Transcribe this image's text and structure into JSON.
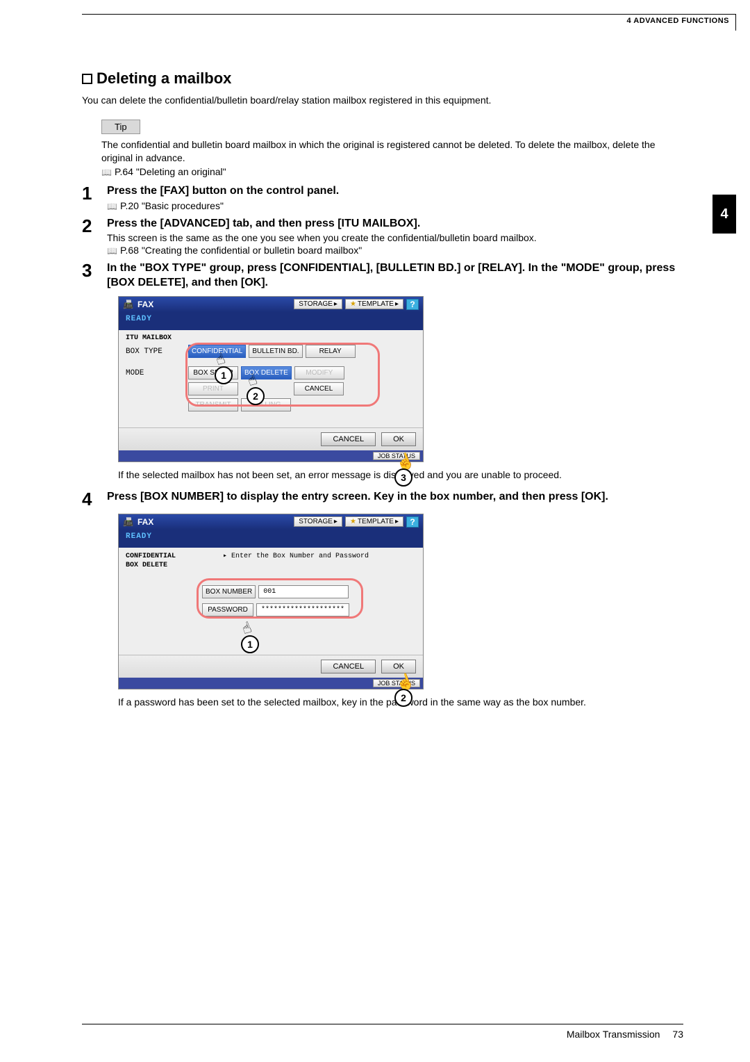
{
  "chapter_header": "4 ADVANCED FUNCTIONS",
  "side_tab": "4",
  "section_title": "Deleting a mailbox",
  "intro": "You can delete the confidential/bulletin board/relay station mailbox registered in this equipment.",
  "tip_label": "Tip",
  "tip_text": "The confidential and bulletin board mailbox in which the original is registered cannot be deleted. To delete the mailbox, delete the original in advance.",
  "tip_ref": "P.64 \"Deleting an original\"",
  "steps": {
    "s1": {
      "num": "1",
      "title": "Press the [FAX] button on the control panel.",
      "ref": "P.20 \"Basic procedures\""
    },
    "s2": {
      "num": "2",
      "title": "Press the [ADVANCED] tab, and then press [ITU MAILBOX].",
      "sub": "This screen is the same as the one you see when you create the confidential/bulletin board mailbox.",
      "ref": "P.68 \"Creating the confidential or bulletin board mailbox\""
    },
    "s3": {
      "num": "3",
      "title": "In the \"BOX TYPE\" group, press [CONFIDENTIAL], [BULLETIN BD.] or [RELAY]. In the \"MODE\" group, press [BOX DELETE], and then [OK].",
      "after": "If the selected mailbox has not been set, an error message is displayed and you are unable to proceed."
    },
    "s4": {
      "num": "4",
      "title": "Press [BOX NUMBER] to display the entry screen. Key in the box number, and then press [OK].",
      "after": "If a password has been set to the selected mailbox, key in the password in the same way as the box number."
    }
  },
  "panel": {
    "app": "FAX",
    "storage": "STORAGE",
    "template": "TEMPLATE",
    "ready": "READY",
    "itu": "ITU MAILBOX",
    "boxtype_lbl": "BOX TYPE",
    "mode_lbl": "MODE",
    "btns": {
      "confidential": "CONFIDENTIAL",
      "bulletin": "BULLETIN BD.",
      "relay": "RELAY",
      "boxsetup": "BOX SETUP",
      "boxdelete": "BOX DELETE",
      "modify": "MODIFY",
      "print": "PRINT",
      "cancel_small": "CANCEL",
      "transmit": "TRANSMIT",
      "polling": "POLLING"
    },
    "footer_cancel": "CANCEL",
    "footer_ok": "OK",
    "status": "JOB STATUS"
  },
  "panel2": {
    "left1": "CONFIDENTIAL",
    "left2": "BOX DELETE",
    "instr": "▸ Enter the Box Number and Password",
    "boxnumber_lbl": "BOX NUMBER",
    "boxnumber_val": "001",
    "password_lbl": "PASSWORD",
    "password_val": "********************"
  },
  "callouts": {
    "c1": "1",
    "c2": "2",
    "c3": "3"
  },
  "footer": {
    "title": "Mailbox Transmission",
    "page": "73"
  }
}
